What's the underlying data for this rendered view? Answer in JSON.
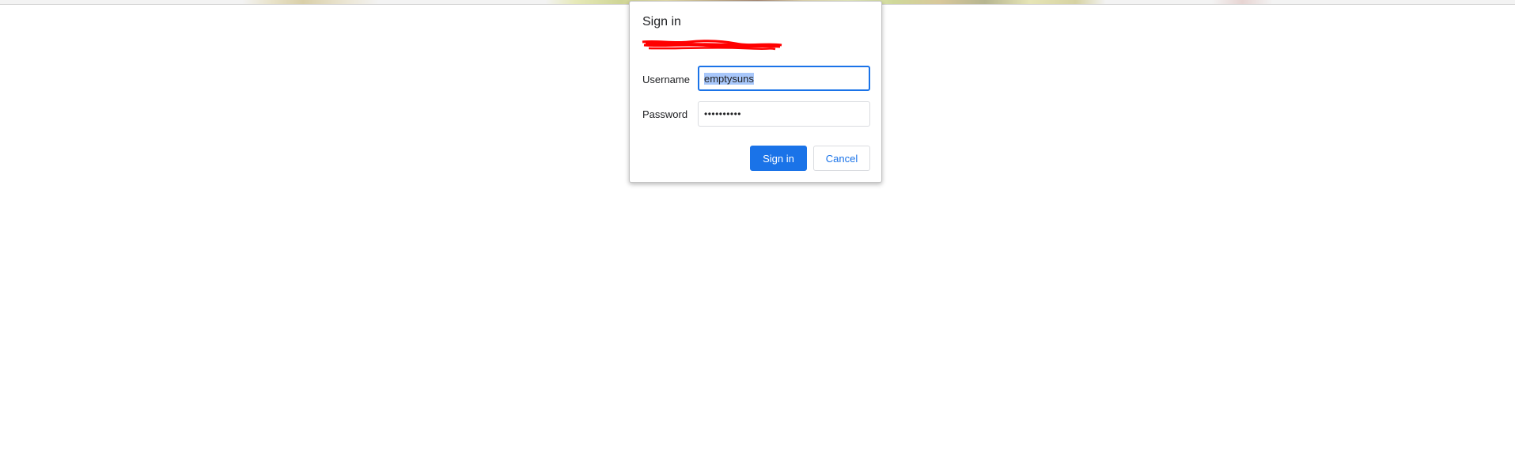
{
  "dialog": {
    "title": "Sign in",
    "username_label": "Username",
    "username_value": "emptysuns",
    "password_label": "Password",
    "password_masked": "••••••••••",
    "signin_label": "Sign in",
    "cancel_label": "Cancel"
  },
  "colors": {
    "accent": "#1a73e8",
    "selection": "#a8c7fa",
    "redaction": "#ff0000"
  }
}
